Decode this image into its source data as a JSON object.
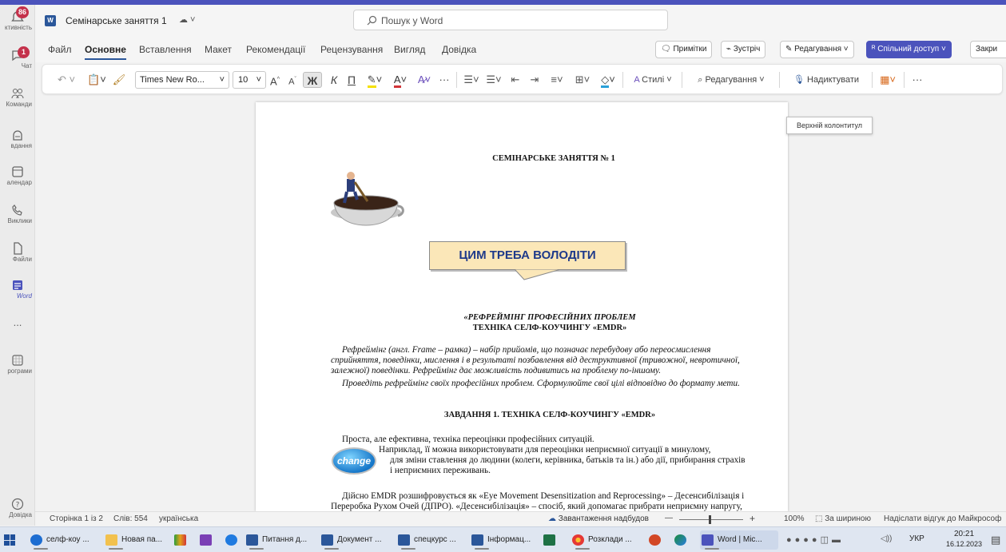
{
  "rail": {
    "activity_badge": "86",
    "chat_badge": "1",
    "items": [
      {
        "label": "ктивність"
      },
      {
        "label": "Чат"
      },
      {
        "label": "Команди"
      },
      {
        "label": "вдання"
      },
      {
        "label": "алендар"
      },
      {
        "label": "Виклики"
      },
      {
        "label": "Файли"
      },
      {
        "label": "Word"
      },
      {
        "label": "..."
      },
      {
        "label": "рограми"
      },
      {
        "label": "Довідка"
      }
    ]
  },
  "header": {
    "doc_title": "Семінарське заняття 1",
    "search_placeholder": "Пошук у Word"
  },
  "tabs": [
    "Файл",
    "Основне",
    "Вставлення",
    "Макет",
    "Рекомендації",
    "Рецензування",
    "Вигляд",
    "Довідка"
  ],
  "header_buttons": {
    "comments": "Примітки",
    "meeting": "Зустріч",
    "editing": "Редагування",
    "share": "Спільний доступ",
    "close": "Закри"
  },
  "toolbar": {
    "font_name": "Times New Ro...",
    "font_size": "10",
    "grow": "A",
    "shrink": "A",
    "bold": "Ж",
    "italic": "К",
    "underline": "П",
    "more": "···",
    "styles": "Стилі",
    "editing": "Редагування",
    "dictate": "Надиктувати",
    "more2": "···"
  },
  "tooltip": "Верхній колонтитул",
  "document": {
    "heading": "СЕМІНАРСЬКЕ ЗАНЯТТЯ № 1",
    "callout": "ЦИМ ТРЕБА ВОЛОДІТИ",
    "subtitle1": "«РЕФРЕЙМІНГ ПРОФЕСІЙНИХ ПРОБЛЕМ",
    "subtitle2": "ТЕХНІКА СЕЛФ-КОУЧИНГУ «EMDR»",
    "para1_l1": "Рефреймінг (англ. Frame – рамка) – набір прийомів, що позначає перебудову або переосмислення",
    "para1_l2": "сприйняття, поведінки, мислення і в результаті позбавлення від деструктивної (тривожної, невротичної,",
    "para1_l3": "залежної) поведінки. Рефреймінг дає можливість подивитись на проблему по-іншому.",
    "para1_l4": "Проведіть рефреймінг своїх професійних проблем. Сформулюйте свої цілі відповідно до формату мети.",
    "task1": "ЗАВДАННЯ 1. ТЕХНІКА СЕЛФ-КОУЧИНГУ «EMDR»",
    "para2_l1": "Проста, але ефективна, техніка переоцінки професійних ситуацій.",
    "para2_l2": "Наприклад, її можна використовувати для переоцінки неприємної ситуації в минулому,",
    "para2_l3": "для зміни ставлення до людини (колеги, керівника, батьків та ін.) або дії, прибирання страхів",
    "para2_l4": "і неприємних переживань.",
    "change_label": "change",
    "para3_l1": "Дійсно EMDR розшифровується як «Eye Movement Desensitization and Reprocessing» – Десенсибілізація і",
    "para3_l2": "Переробка Рухом Очей (ДПРО). «Десенсибілізація» – спосіб, який допомагає прибрати неприємну напругу,"
  },
  "status": {
    "page": "Сторінка 1 із 2",
    "words": "Слів: 554",
    "lang": "українська",
    "addins": "Завантаження надбудов",
    "minus": "—",
    "plus": "+",
    "zoom": "100%",
    "fit": "За шириною",
    "feedback": "Надіслати відгук до Майкрософ"
  },
  "taskbar": {
    "items": [
      "селф-коу ...",
      "Новая па...",
      "",
      "",
      "",
      "Питання д...",
      "Документ ...",
      "спецкурс ...",
      "Інформац...",
      "",
      "Розклади ...",
      "",
      "",
      "Word | Mic..."
    ],
    "lang": "УКР",
    "time": "20:21",
    "date": "16.12.2023"
  }
}
